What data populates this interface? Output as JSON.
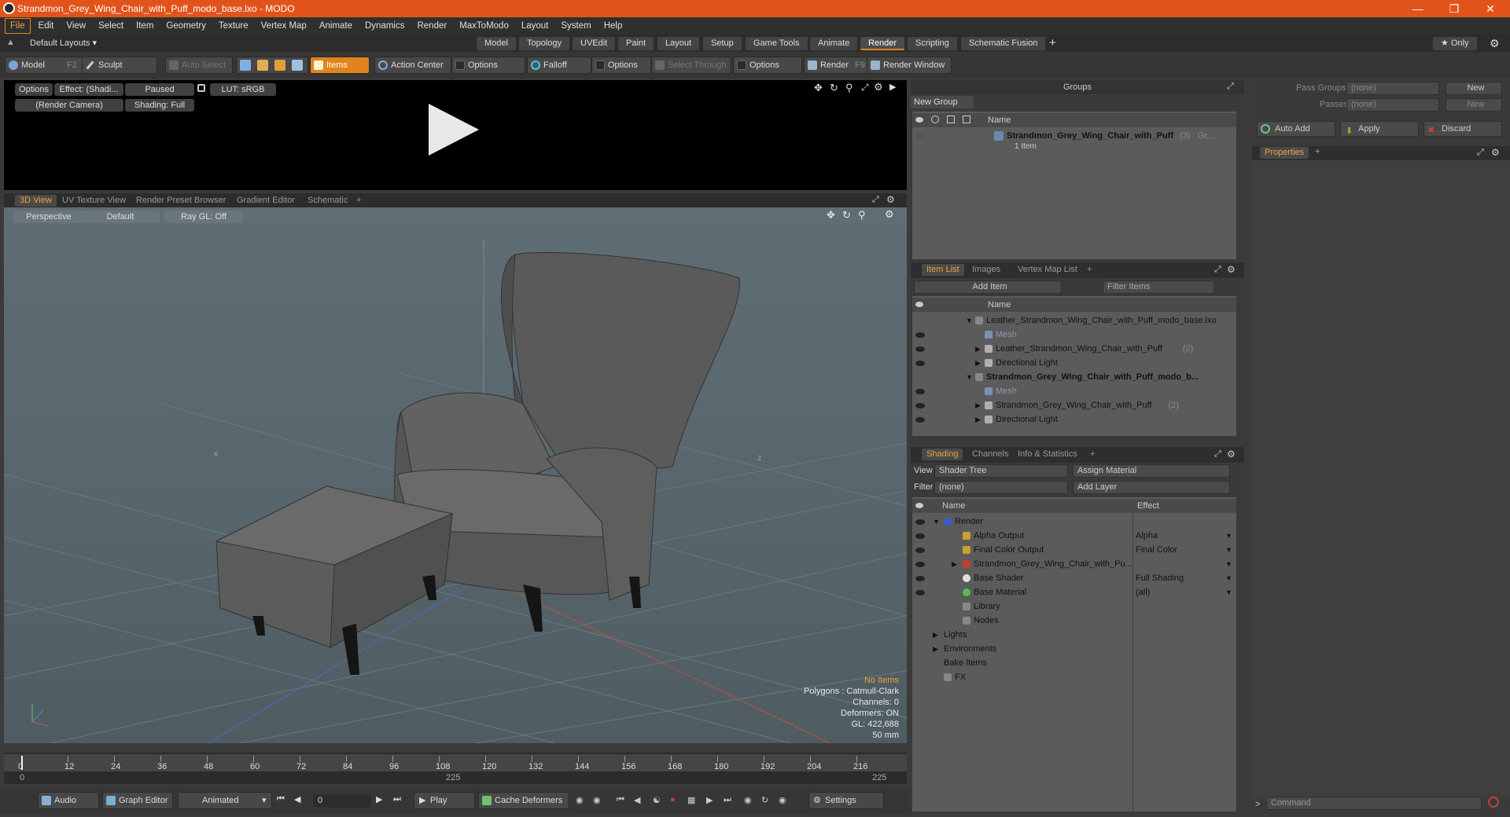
{
  "window": {
    "title": "Strandmon_Grey_Wing_Chair_with_Puff_modo_base.lxo - MODO",
    "controls": [
      "minimize-icon",
      "restore-icon",
      "close-icon"
    ]
  },
  "menu": [
    "File",
    "Edit",
    "View",
    "Select",
    "Item",
    "Geometry",
    "Texture",
    "Vertex Map",
    "Animate",
    "Dynamics",
    "Render",
    "MaxToModo",
    "Layout",
    "System",
    "Help"
  ],
  "layouts": {
    "preset": "Default Layouts ▾",
    "tabs": [
      "Model",
      "Topology",
      "UVEdit",
      "Paint",
      "Layout",
      "Setup",
      "Game Tools",
      "Animate",
      "Render",
      "Scripting",
      "Schematic Fusion"
    ],
    "active": "Render",
    "add": "+",
    "only": "★ Only"
  },
  "toolbar": {
    "model": "Model",
    "model_key": "F2",
    "sculpt": "Sculpt",
    "auto_select": "Auto Select",
    "items": "Items",
    "action_center": "Action Center",
    "options1": "Options",
    "falloff": "Falloff",
    "options2": "Options",
    "select_through": "Select Through",
    "options3": "Options",
    "render": "Render",
    "render_key": "F9",
    "render_window": "Render Window"
  },
  "render_preview": {
    "options": "Options",
    "effect": "Effect: (Shadi...",
    "paused": "Paused",
    "lut": "LUT: sRGB",
    "camera": "(Render Camera)",
    "shading": "Shading: Full"
  },
  "view_tabs": [
    "3D View",
    "UV Texture View",
    "Render Preset Browser",
    "Gradient Editor",
    "Schematic",
    "+"
  ],
  "viewport": {
    "projection": "Perspective",
    "style": "Default",
    "raygl": "Ray GL: Off",
    "hud": [
      "No Items",
      "Polygons : Catmull-Clark",
      "Channels: 0",
      "Deformers: ON",
      "GL: 422,688",
      "50 mm"
    ]
  },
  "timeline": {
    "ticks": [
      "0",
      "12",
      "24",
      "36",
      "48",
      "60",
      "72",
      "84",
      "96",
      "108",
      "120",
      "132",
      "144",
      "156",
      "168",
      "180",
      "192",
      "204",
      "216"
    ],
    "start": "0",
    "mid": "225",
    "end": "225"
  },
  "bottom": {
    "audio": "Audio",
    "graph_editor": "Graph Editor",
    "animated": "Animated",
    "frame": "0",
    "play": "Play",
    "cache": "Cache Deformers",
    "settings": "Settings"
  },
  "groups": {
    "title": "Groups",
    "new_group": "New Group",
    "name_col": "Name",
    "item_name": "Strandmon_Grey_Wing_Chair_with_Puff",
    "item_suffix": "(3) : Gr...",
    "item_sub": "1 Item"
  },
  "item_list": {
    "tabs": [
      "Item List",
      "Images",
      "Vertex Map List",
      "+"
    ],
    "add_item": "Add Item",
    "filter": "Filter Items",
    "name_col": "Name",
    "rows": [
      {
        "label": "Leather_Strandmon_Wing_Chair_with_Puff_modo_base.lxo",
        "indent": 0,
        "bold": false,
        "dim": false,
        "suffix": ""
      },
      {
        "label": "Mesh",
        "indent": 1,
        "bold": false,
        "dim": true,
        "suffix": ""
      },
      {
        "label": "Leather_Strandmon_Wing_Chair_with_Puff",
        "indent": 1,
        "bold": false,
        "dim": false,
        "suffix": "(2)"
      },
      {
        "label": "Directional Light",
        "indent": 1,
        "bold": false,
        "dim": false,
        "suffix": ""
      },
      {
        "label": "Strandmon_Grey_Wing_Chair_with_Puff_modo_b...",
        "indent": 0,
        "bold": true,
        "dim": false,
        "suffix": ""
      },
      {
        "label": "Mesh",
        "indent": 1,
        "bold": false,
        "dim": true,
        "suffix": ""
      },
      {
        "label": "Strandmon_Grey_Wing_Chair_with_Puff",
        "indent": 1,
        "bold": false,
        "dim": false,
        "suffix": "(2)"
      },
      {
        "label": "Directional Light",
        "indent": 1,
        "bold": false,
        "dim": false,
        "suffix": ""
      }
    ]
  },
  "shading": {
    "tabs": [
      "Shading",
      "Channels",
      "Info & Statistics",
      "+"
    ],
    "view_label": "View",
    "view_value": "Shader Tree",
    "assign": "Assign Material",
    "filter_label": "Filter",
    "filter_value": "(none)",
    "add_layer": "Add Layer",
    "name_col": "Name",
    "effect_col": "Effect",
    "rows": [
      {
        "label": "Render",
        "effect": "",
        "indent": 0
      },
      {
        "label": "Alpha Output",
        "effect": "Alpha",
        "indent": 1
      },
      {
        "label": "Final Color Output",
        "effect": "Final Color",
        "indent": 1
      },
      {
        "label": "Strandmon_Grey_Wing_Chair_with_Pu...",
        "effect": "",
        "indent": 1
      },
      {
        "label": "Base Shader",
        "effect": "Full Shading",
        "indent": 1
      },
      {
        "label": "Base Material",
        "effect": "(all)",
        "indent": 1
      },
      {
        "label": "Library",
        "effect": "",
        "indent": 1
      },
      {
        "label": "Nodes",
        "effect": "",
        "indent": 1
      },
      {
        "label": "Lights",
        "effect": "",
        "indent": 0
      },
      {
        "label": "Environments",
        "effect": "",
        "indent": 0
      },
      {
        "label": "Bake Items",
        "effect": "",
        "indent": 0
      },
      {
        "label": "FX",
        "effect": "",
        "indent": 0
      }
    ]
  },
  "passes": {
    "pass_groups": "Pass Groups",
    "passes": "Passes",
    "none": "(none)",
    "new": "New",
    "auto_add": "Auto Add",
    "apply": "Apply",
    "discard": "Discard",
    "properties": "Properties",
    "command": "Command"
  }
}
